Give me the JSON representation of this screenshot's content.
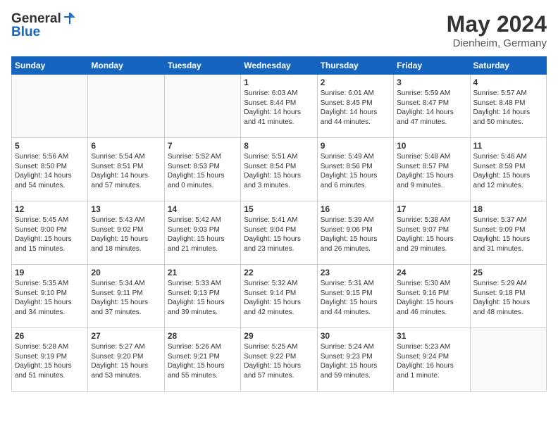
{
  "header": {
    "logo_general": "General",
    "logo_blue": "Blue",
    "month": "May 2024",
    "location": "Dienheim, Germany"
  },
  "weekdays": [
    "Sunday",
    "Monday",
    "Tuesday",
    "Wednesday",
    "Thursday",
    "Friday",
    "Saturday"
  ],
  "weeks": [
    [
      {
        "day": "",
        "info": ""
      },
      {
        "day": "",
        "info": ""
      },
      {
        "day": "",
        "info": ""
      },
      {
        "day": "1",
        "info": "Sunrise: 6:03 AM\nSunset: 8:44 PM\nDaylight: 14 hours\nand 41 minutes."
      },
      {
        "day": "2",
        "info": "Sunrise: 6:01 AM\nSunset: 8:45 PM\nDaylight: 14 hours\nand 44 minutes."
      },
      {
        "day": "3",
        "info": "Sunrise: 5:59 AM\nSunset: 8:47 PM\nDaylight: 14 hours\nand 47 minutes."
      },
      {
        "day": "4",
        "info": "Sunrise: 5:57 AM\nSunset: 8:48 PM\nDaylight: 14 hours\nand 50 minutes."
      }
    ],
    [
      {
        "day": "5",
        "info": "Sunrise: 5:56 AM\nSunset: 8:50 PM\nDaylight: 14 hours\nand 54 minutes."
      },
      {
        "day": "6",
        "info": "Sunrise: 5:54 AM\nSunset: 8:51 PM\nDaylight: 14 hours\nand 57 minutes."
      },
      {
        "day": "7",
        "info": "Sunrise: 5:52 AM\nSunset: 8:53 PM\nDaylight: 15 hours\nand 0 minutes."
      },
      {
        "day": "8",
        "info": "Sunrise: 5:51 AM\nSunset: 8:54 PM\nDaylight: 15 hours\nand 3 minutes."
      },
      {
        "day": "9",
        "info": "Sunrise: 5:49 AM\nSunset: 8:56 PM\nDaylight: 15 hours\nand 6 minutes."
      },
      {
        "day": "10",
        "info": "Sunrise: 5:48 AM\nSunset: 8:57 PM\nDaylight: 15 hours\nand 9 minutes."
      },
      {
        "day": "11",
        "info": "Sunrise: 5:46 AM\nSunset: 8:59 PM\nDaylight: 15 hours\nand 12 minutes."
      }
    ],
    [
      {
        "day": "12",
        "info": "Sunrise: 5:45 AM\nSunset: 9:00 PM\nDaylight: 15 hours\nand 15 minutes."
      },
      {
        "day": "13",
        "info": "Sunrise: 5:43 AM\nSunset: 9:02 PM\nDaylight: 15 hours\nand 18 minutes."
      },
      {
        "day": "14",
        "info": "Sunrise: 5:42 AM\nSunset: 9:03 PM\nDaylight: 15 hours\nand 21 minutes."
      },
      {
        "day": "15",
        "info": "Sunrise: 5:41 AM\nSunset: 9:04 PM\nDaylight: 15 hours\nand 23 minutes."
      },
      {
        "day": "16",
        "info": "Sunrise: 5:39 AM\nSunset: 9:06 PM\nDaylight: 15 hours\nand 26 minutes."
      },
      {
        "day": "17",
        "info": "Sunrise: 5:38 AM\nSunset: 9:07 PM\nDaylight: 15 hours\nand 29 minutes."
      },
      {
        "day": "18",
        "info": "Sunrise: 5:37 AM\nSunset: 9:09 PM\nDaylight: 15 hours\nand 31 minutes."
      }
    ],
    [
      {
        "day": "19",
        "info": "Sunrise: 5:35 AM\nSunset: 9:10 PM\nDaylight: 15 hours\nand 34 minutes."
      },
      {
        "day": "20",
        "info": "Sunrise: 5:34 AM\nSunset: 9:11 PM\nDaylight: 15 hours\nand 37 minutes."
      },
      {
        "day": "21",
        "info": "Sunrise: 5:33 AM\nSunset: 9:13 PM\nDaylight: 15 hours\nand 39 minutes."
      },
      {
        "day": "22",
        "info": "Sunrise: 5:32 AM\nSunset: 9:14 PM\nDaylight: 15 hours\nand 42 minutes."
      },
      {
        "day": "23",
        "info": "Sunrise: 5:31 AM\nSunset: 9:15 PM\nDaylight: 15 hours\nand 44 minutes."
      },
      {
        "day": "24",
        "info": "Sunrise: 5:30 AM\nSunset: 9:16 PM\nDaylight: 15 hours\nand 46 minutes."
      },
      {
        "day": "25",
        "info": "Sunrise: 5:29 AM\nSunset: 9:18 PM\nDaylight: 15 hours\nand 48 minutes."
      }
    ],
    [
      {
        "day": "26",
        "info": "Sunrise: 5:28 AM\nSunset: 9:19 PM\nDaylight: 15 hours\nand 51 minutes."
      },
      {
        "day": "27",
        "info": "Sunrise: 5:27 AM\nSunset: 9:20 PM\nDaylight: 15 hours\nand 53 minutes."
      },
      {
        "day": "28",
        "info": "Sunrise: 5:26 AM\nSunset: 9:21 PM\nDaylight: 15 hours\nand 55 minutes."
      },
      {
        "day": "29",
        "info": "Sunrise: 5:25 AM\nSunset: 9:22 PM\nDaylight: 15 hours\nand 57 minutes."
      },
      {
        "day": "30",
        "info": "Sunrise: 5:24 AM\nSunset: 9:23 PM\nDaylight: 15 hours\nand 59 minutes."
      },
      {
        "day": "31",
        "info": "Sunrise: 5:23 AM\nSunset: 9:24 PM\nDaylight: 16 hours\nand 1 minute."
      },
      {
        "day": "",
        "info": ""
      }
    ]
  ]
}
